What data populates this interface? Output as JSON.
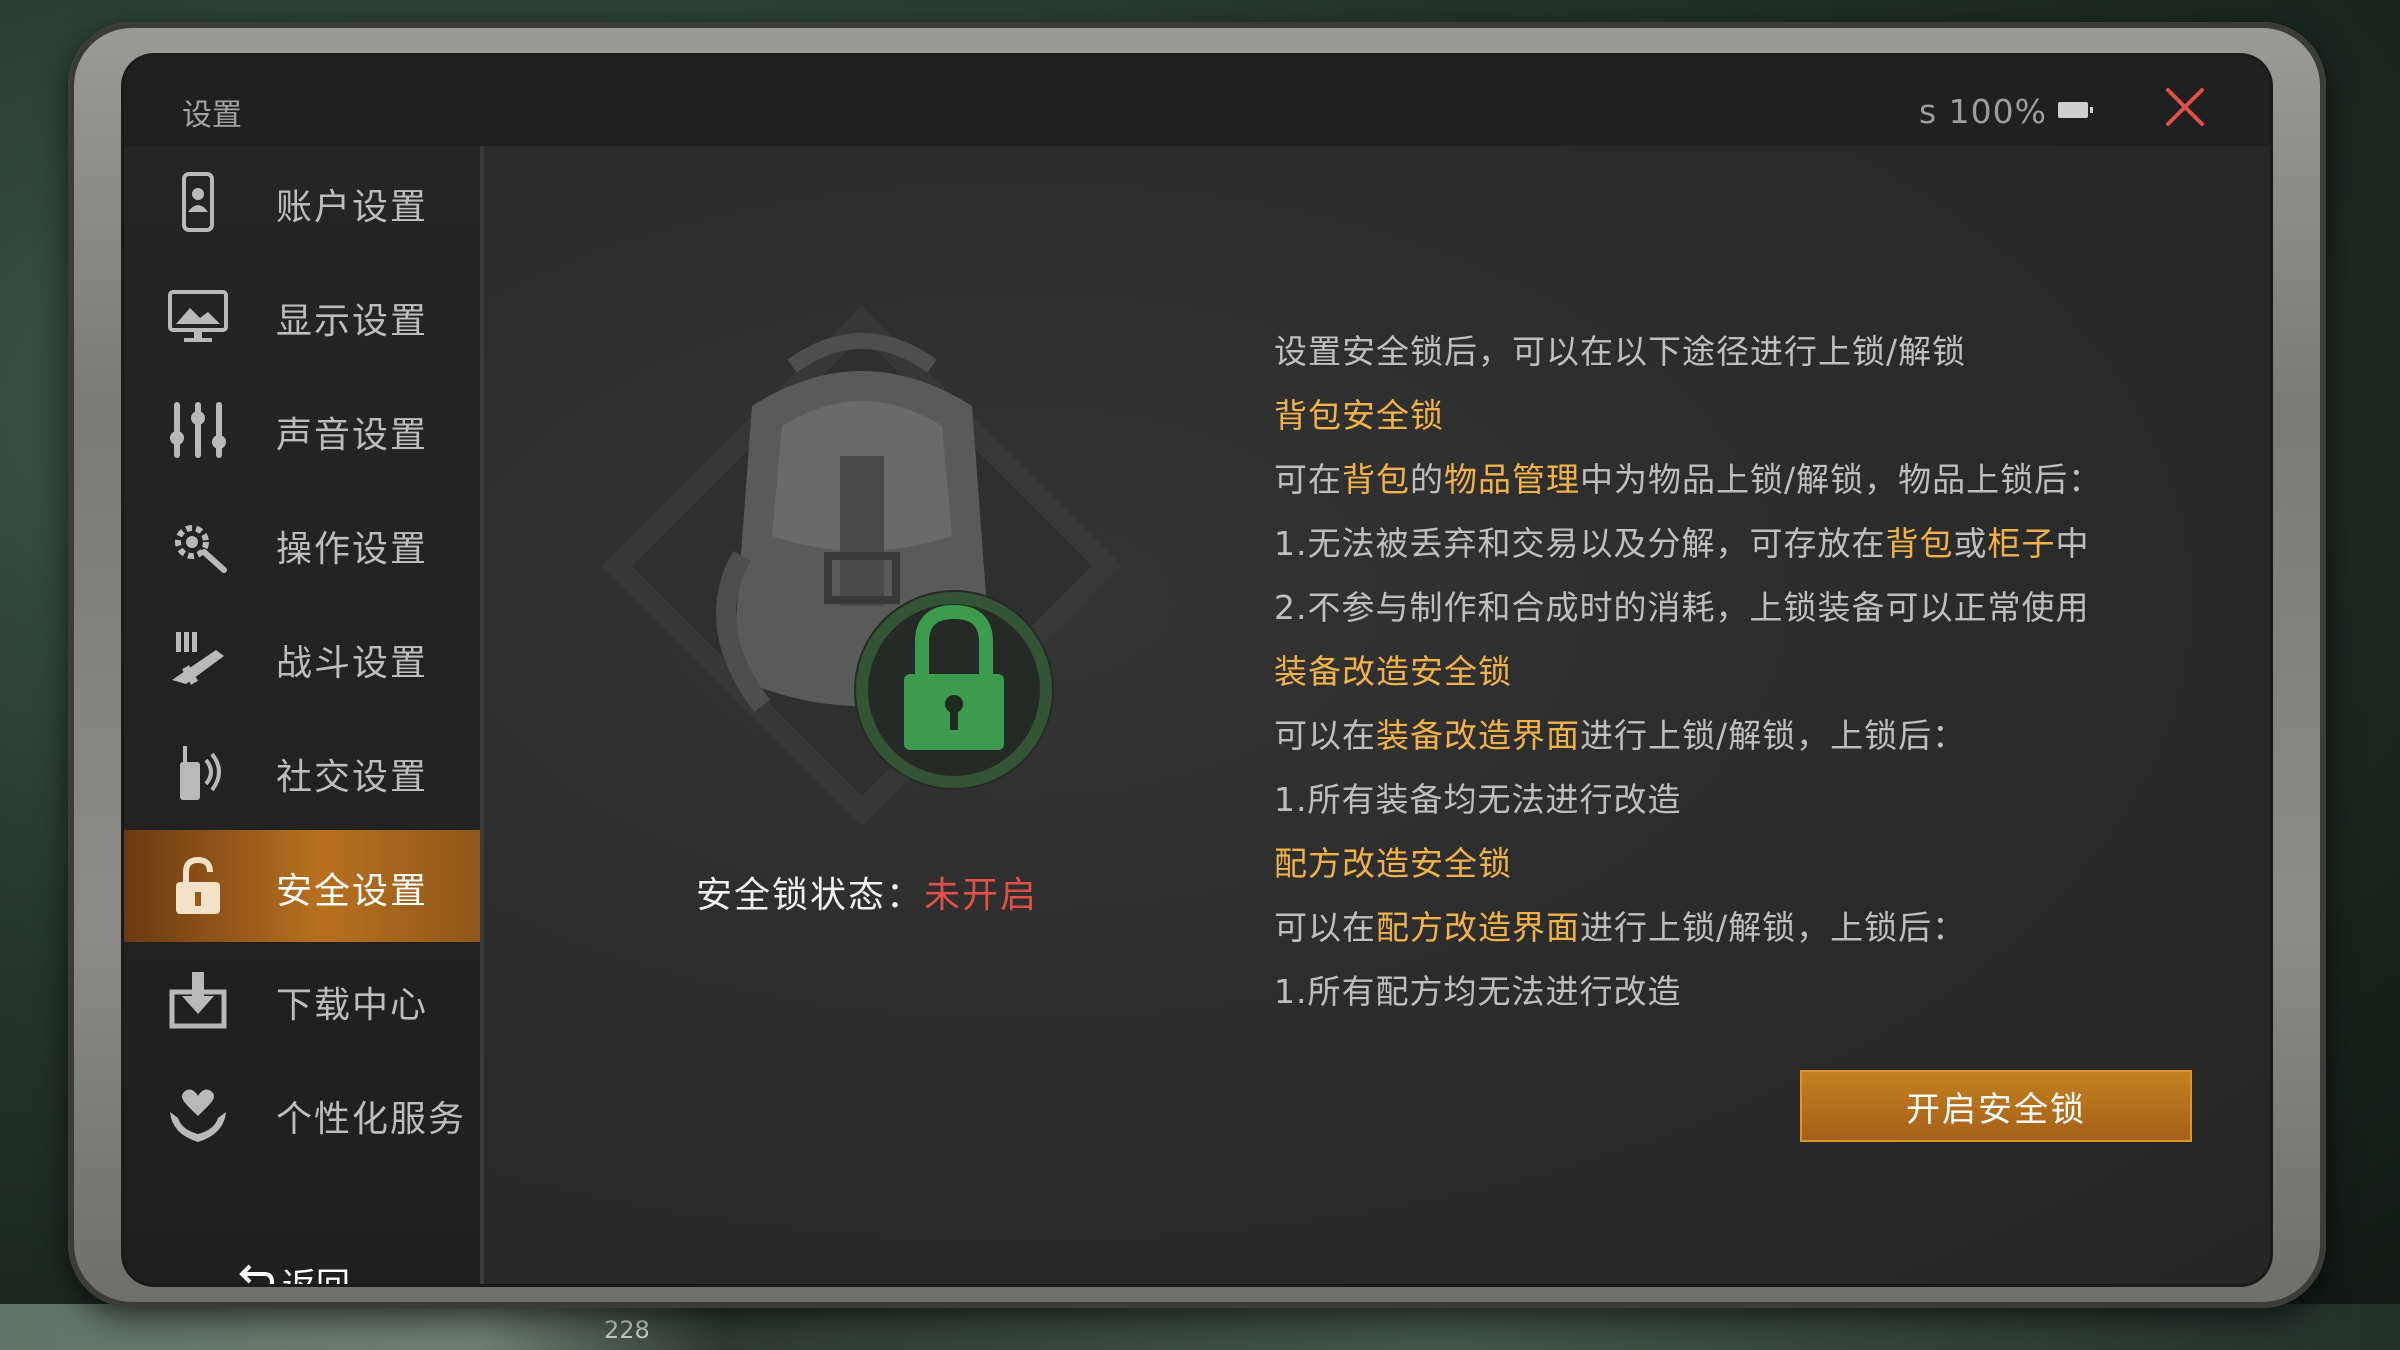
{
  "window": {
    "title": "设置",
    "status_text": "s 100%"
  },
  "sidebar": {
    "items": [
      {
        "label": "账户设置",
        "icon": "account-icon"
      },
      {
        "label": "显示设置",
        "icon": "display-icon"
      },
      {
        "label": "声音设置",
        "icon": "sound-sliders-icon"
      },
      {
        "label": "操作设置",
        "icon": "gear-control-icon"
      },
      {
        "label": "战斗设置",
        "icon": "combat-weapon-icon"
      },
      {
        "label": "社交设置",
        "icon": "walkie-talkie-icon"
      },
      {
        "label": "安全设置",
        "icon": "lock-icon",
        "active": true
      },
      {
        "label": "下载中心",
        "icon": "download-icon"
      },
      {
        "label": "个性化服务",
        "icon": "heart-hands-icon"
      }
    ],
    "back_label": "返回"
  },
  "content": {
    "lock_status_label": "安全锁状态：",
    "lock_status_value": "未开启",
    "info_intro": "设置安全锁后，可以在以下途径进行上锁/解锁",
    "section_bag_title": "背包安全锁",
    "bag_desc": {
      "p1": "可在",
      "hl1": "背包",
      "p2": "的",
      "hl2": "物品管理",
      "p3": "中为物品上锁/解锁，物品上锁后："
    },
    "bag_rule1": {
      "p1": "1.无法被丢弃和交易以及分解，可存放在",
      "hl1": "背包",
      "p2": "或",
      "hl2": "柜子",
      "p3": "中"
    },
    "bag_rule2": "2.不参与制作和合成时的消耗，上锁装备可以正常使用",
    "section_equip_title": "装备改造安全锁",
    "equip_desc": {
      "p1": "可以在",
      "hl1": "装备改造界面",
      "p2": "进行上锁/解锁，上锁后："
    },
    "equip_rule1": "1.所有装备均无法进行改造",
    "section_recipe_title": "配方改造安全锁",
    "recipe_desc": {
      "p1": "可以在",
      "hl1": "配方改造界面",
      "p2": "进行上锁/解锁，上锁后："
    },
    "recipe_rule1": "1.所有配方均无法进行改造",
    "enable_button": "开启安全锁"
  },
  "background": {
    "bottom_number": "228"
  },
  "colors": {
    "accent_orange": "#c4801f",
    "highlight_text": "#f2b24a",
    "status_off_red": "#e0504a",
    "lock_green": "#3c9b4c"
  }
}
